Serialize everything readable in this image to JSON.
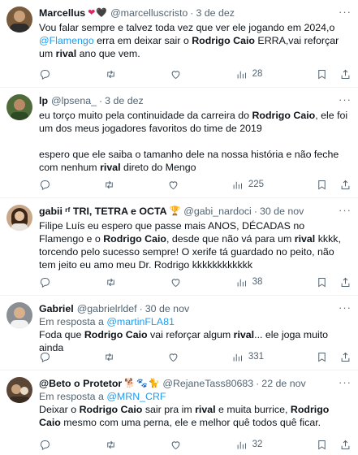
{
  "tweets": [
    {
      "name": "Marcellus",
      "handle": "@marcelluscristo",
      "date": "3 de dez",
      "emoji": [
        "❤",
        "🖤"
      ],
      "reply_to": null,
      "text_parts": [
        {
          "t": "Vou falar sempre e talvez toda vez que ver ele jogando em 2024,o ",
          "s": "n"
        },
        {
          "t": "@Flamengo",
          "s": "link"
        },
        {
          "t": " erra em deixar sair o ",
          "s": "n"
        },
        {
          "t": "Rodrigo Caio",
          "s": "b"
        },
        {
          "t": " ERRA,vai reforçar um ",
          "s": "n"
        },
        {
          "t": "rival",
          "s": "b"
        },
        {
          "t": " ano que vem.",
          "s": "n"
        }
      ],
      "views": "28",
      "avatar_color": "#7a5a3c"
    },
    {
      "name": "lp",
      "handle": "@lpsena_",
      "date": "3 de dez",
      "emoji": [],
      "reply_to": null,
      "text_parts": [
        {
          "t": "eu torço muito pela continuidade da carreira do ",
          "s": "n"
        },
        {
          "t": "Rodrigo Caio",
          "s": "b"
        },
        {
          "t": ", ele foi um dos meus jogadores favoritos do time de 2019\n\nespero que ele saiba o tamanho dele na nossa história e não feche com nenhum ",
          "s": "n"
        },
        {
          "t": "rival",
          "s": "b"
        },
        {
          "t": " direto do Mengo",
          "s": "n"
        }
      ],
      "views": "225",
      "avatar_color": "#4f6b3a"
    },
    {
      "name": "gabii ʳᶠ TRI, TETRA e OCTA",
      "handle": "@gabi_nardoci",
      "date": "30 de nov",
      "emoji": [
        "🏆"
      ],
      "reply_to": null,
      "text_parts": [
        {
          "t": "Filipe Luís eu espero que passe mais ANOS, DÉCADAS no Flamengo e o ",
          "s": "n"
        },
        {
          "t": "Rodrigo Caio",
          "s": "b"
        },
        {
          "t": ", desde que não vá para um ",
          "s": "n"
        },
        {
          "t": "rival",
          "s": "b"
        },
        {
          "t": " kkkk, torcendo pelo sucesso sempre! O xerife tá guardado no peito, não tem jeito eu amo meu Dr. Rodrigo kkkkkkkkkkkk",
          "s": "n"
        }
      ],
      "views": "38",
      "avatar_color": "#c9a88a"
    },
    {
      "name": "Gabriel",
      "handle": "@gabrielrldef",
      "date": "30 de nov",
      "emoji": [],
      "reply_to": {
        "prefix": "Em resposta a",
        "handle": "@martinFLA81"
      },
      "text_parts": [
        {
          "t": "Foda que ",
          "s": "n"
        },
        {
          "t": "Rodrigo Caio",
          "s": "b"
        },
        {
          "t": " vai reforçar algum ",
          "s": "n"
        },
        {
          "t": "rival",
          "s": "b"
        },
        {
          "t": "... ele joga muito ainda",
          "s": "n"
        }
      ],
      "views": "331",
      "avatar_color": "#8a8f96"
    },
    {
      "name": "@Beto o Protetor",
      "handle": "@RejaneTass80683",
      "date": "22 de nov",
      "emoji": [
        "🐕",
        "🐾",
        "🐈"
      ],
      "reply_to": {
        "prefix": "Em resposta a",
        "handle": "@MRN_CRF"
      },
      "text_parts": [
        {
          "t": "Deixar o ",
          "s": "n"
        },
        {
          "t": "Rodrigo Caio",
          "s": "b"
        },
        {
          "t": " sair pra im ",
          "s": "n"
        },
        {
          "t": "rival",
          "s": "b"
        },
        {
          "t": " e muita burrice, ",
          "s": "n"
        },
        {
          "t": "Rodrigo Caio",
          "s": "b"
        },
        {
          "t": " mesmo com uma perna, ele e melhor quê todos quê ficar.",
          "s": "n"
        }
      ],
      "views": "32",
      "avatar_color": "#5b4636"
    }
  ]
}
